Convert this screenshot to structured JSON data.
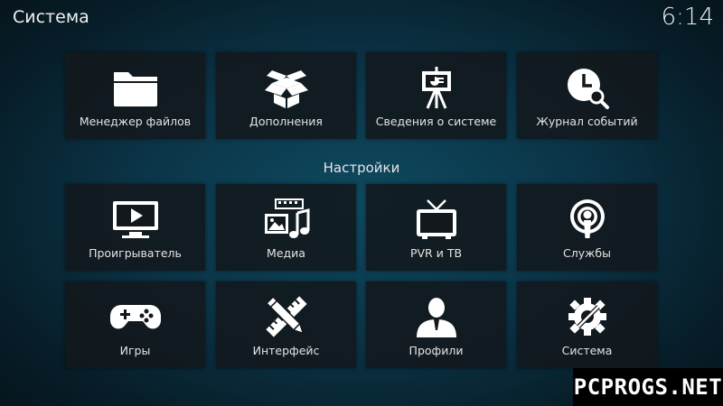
{
  "header": {
    "title": "Система",
    "clock": "6:14"
  },
  "top_tiles": [
    {
      "label": "Менеджер файлов",
      "icon": "folder-icon"
    },
    {
      "label": "Дополнения",
      "icon": "open-box-icon"
    },
    {
      "label": "Сведения о системе",
      "icon": "presentation-easel-icon"
    },
    {
      "label": "Журнал событий",
      "icon": "clock-search-icon"
    }
  ],
  "settings": {
    "title": "Настройки",
    "tiles": [
      {
        "label": "Проигрыватель",
        "icon": "play-monitor-icon"
      },
      {
        "label": "Медиа",
        "icon": "media-film-image-music-icon"
      },
      {
        "label": "PVR и ТВ",
        "icon": "tv-antenna-icon"
      },
      {
        "label": "Службы",
        "icon": "podcast-broadcast-icon"
      },
      {
        "label": "Игры",
        "icon": "gamepad-icon"
      },
      {
        "label": "Интерфейс",
        "icon": "pencil-ruler-icon"
      },
      {
        "label": "Профили",
        "icon": "user-profile-icon"
      },
      {
        "label": "Система",
        "icon": "gear-wrench-icon"
      }
    ]
  },
  "watermark": "PCPROGS.NET"
}
